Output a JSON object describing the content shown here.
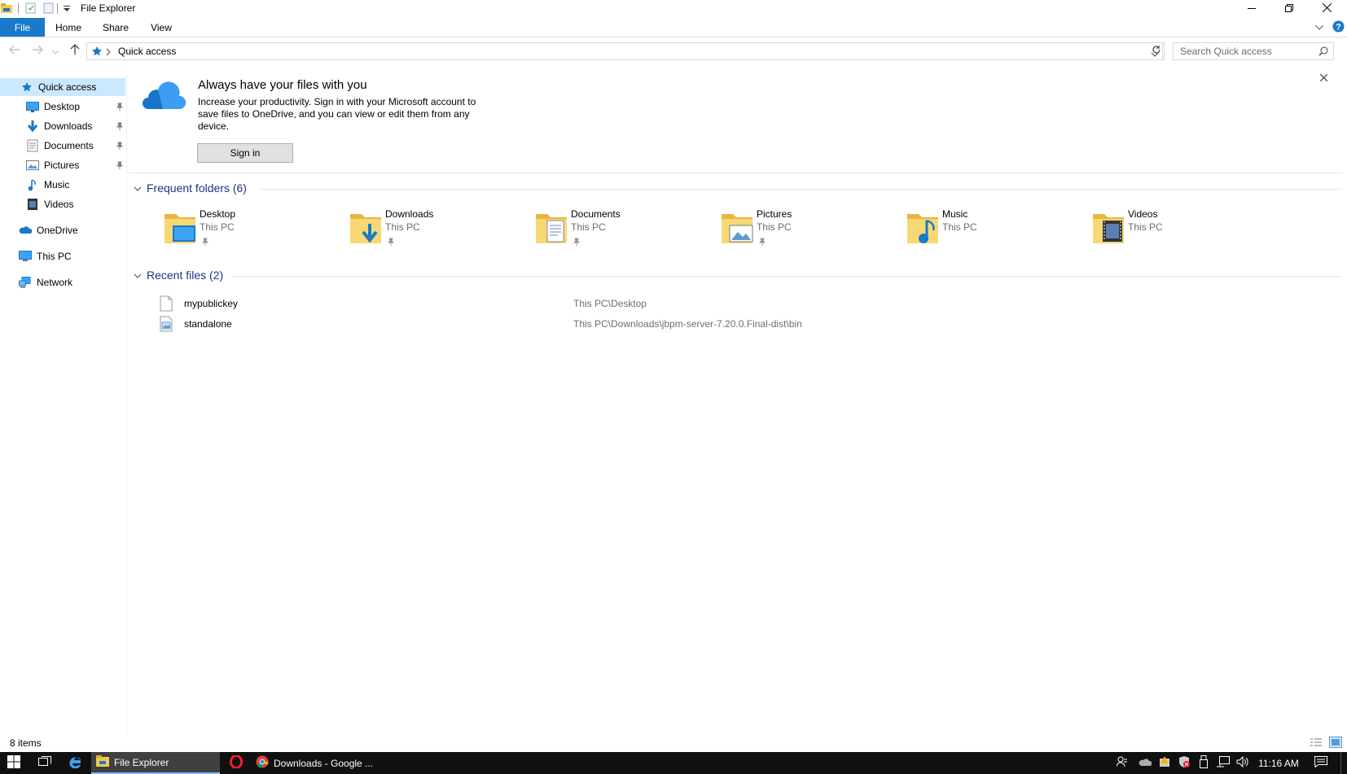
{
  "window": {
    "title": "File Explorer",
    "minimize_icon": "minimize-icon",
    "restore_icon": "restore-icon",
    "close_icon": "close-icon"
  },
  "ribbon": {
    "tabs": [
      {
        "label": "File"
      },
      {
        "label": "Home"
      },
      {
        "label": "Share"
      },
      {
        "label": "View"
      }
    ]
  },
  "address": {
    "path": "Quick access",
    "search_placeholder": "Search Quick access"
  },
  "nav": {
    "quick_access": "Quick access",
    "pinned": [
      {
        "label": "Desktop",
        "pinned": true
      },
      {
        "label": "Downloads",
        "pinned": true
      },
      {
        "label": "Documents",
        "pinned": true
      },
      {
        "label": "Pictures",
        "pinned": true
      },
      {
        "label": "Music",
        "pinned": false
      },
      {
        "label": "Videos",
        "pinned": false
      }
    ],
    "onedrive": "OneDrive",
    "this_pc": "This PC",
    "network": "Network"
  },
  "banner": {
    "title": "Always have your files with you",
    "line1": "Increase your productivity. Sign in with your Microsoft account to",
    "line2": "save files to OneDrive, and you can view or edit them from any",
    "line3": "device.",
    "button": "Sign in"
  },
  "frequent": {
    "header": "Frequent folders (6)",
    "folders": [
      {
        "name": "Desktop",
        "location": "This PC"
      },
      {
        "name": "Downloads",
        "location": "This PC"
      },
      {
        "name": "Documents",
        "location": "This PC"
      },
      {
        "name": "Pictures",
        "location": "This PC"
      },
      {
        "name": "Music",
        "location": "This PC"
      },
      {
        "name": "Videos",
        "location": "This PC"
      }
    ]
  },
  "recent": {
    "header": "Recent files (2)",
    "files": [
      {
        "name": "mypublickey",
        "path": "This PC\\Desktop"
      },
      {
        "name": "standalone",
        "path": "This PC\\Downloads\\jbpm-server-7.20.0.Final-dist\\bin"
      }
    ]
  },
  "status": {
    "items": "8 items"
  },
  "taskbar": {
    "apps": [
      {
        "label": "File Explorer"
      },
      {
        "label": "Downloads - Google ..."
      }
    ],
    "clock": "11:16 AM"
  },
  "colors": {
    "accent": "#1979ca",
    "folder": "#f3c94f",
    "header_text": "#1e3287",
    "taskbar": "#101010"
  }
}
